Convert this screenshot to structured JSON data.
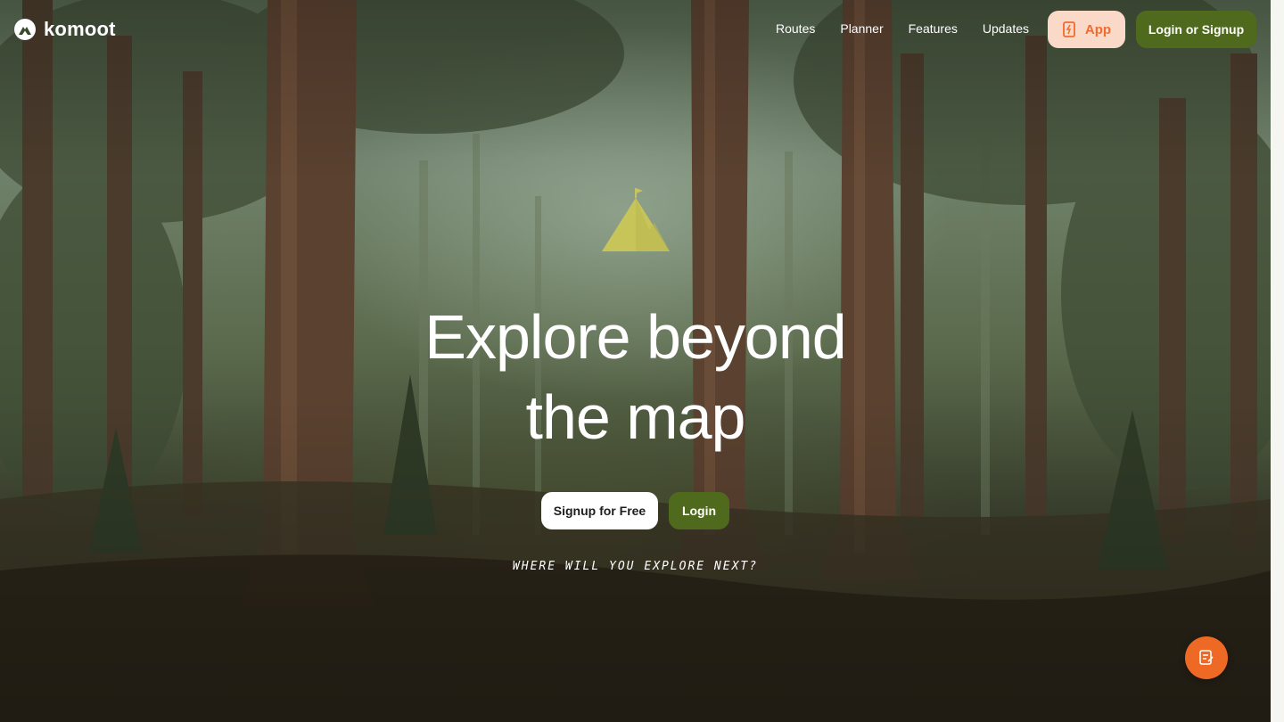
{
  "brand": {
    "name": "komoot"
  },
  "nav": {
    "items": [
      "Routes",
      "Planner",
      "Features",
      "Updates"
    ]
  },
  "header": {
    "app_label": "App",
    "login_signup_label": "Login or Signup"
  },
  "hero": {
    "headline_line1": "Explore beyond",
    "headline_line2": "the map",
    "signup_label": "Signup for Free",
    "login_label": "Login",
    "tagline": "WHERE WILL YOU EXPLORE NEXT?"
  },
  "icons": {
    "logo": "komoot-logo-icon",
    "app": "phone-icon",
    "peak": "mountain-flag-icon",
    "fab": "feedback-icon"
  },
  "colors": {
    "accent_green": "#4f6a1c",
    "accent_orange": "#ee6a24",
    "app_button_bg": "#fbd9c9",
    "peak_yellow": "#c7c55a"
  }
}
